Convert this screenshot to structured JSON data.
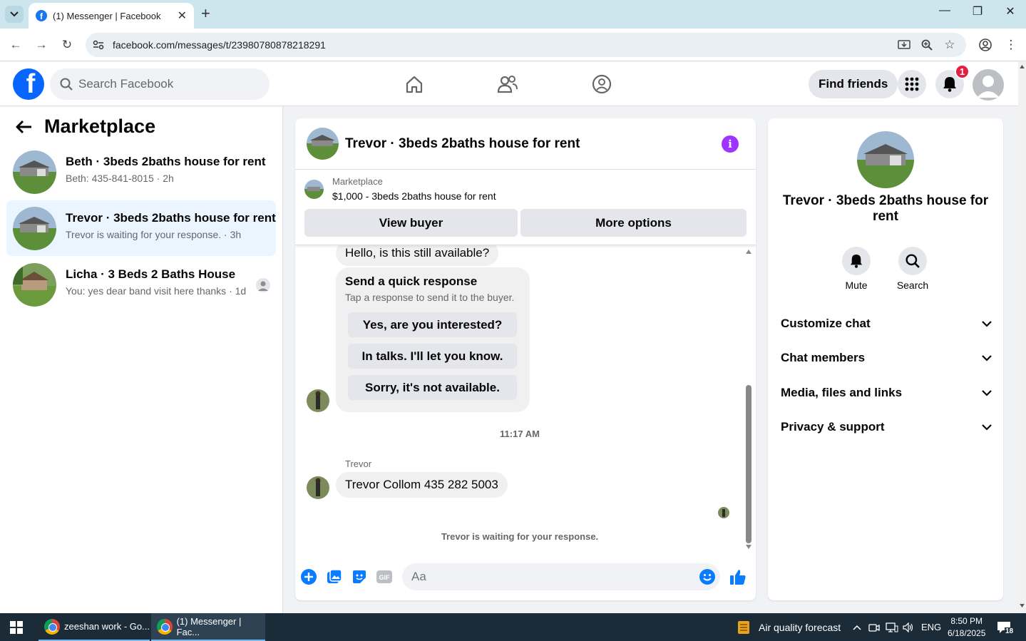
{
  "browser": {
    "tab_title": "(1) Messenger | Facebook",
    "url": "facebook.com/messages/t/23980780878218291"
  },
  "fb_header": {
    "search_placeholder": "Search Facebook",
    "find_friends": "Find friends",
    "notification_count": "1"
  },
  "left_panel": {
    "title": "Marketplace",
    "conversations": [
      {
        "name": "Beth · 3beds 2baths house for rent",
        "preview": "Beth: 435-841-8015 · 2h"
      },
      {
        "name": "Trevor · 3beds 2baths house for rent",
        "preview": "Trevor is waiting for your response. · 3h"
      },
      {
        "name": "Licha · 3 Beds 2 Baths House",
        "preview": "You: yes dear band visit here thanks · 1d"
      }
    ]
  },
  "chat": {
    "title": "Trevor · 3beds 2baths house for rent",
    "listing_source": "Marketplace",
    "listing_price": "$1,000 - 3beds 2baths house for rent",
    "view_buyer": "View buyer",
    "more_options": "More options",
    "first_message": "Hello, is this still available?",
    "quick_response_title": "Send a quick response",
    "quick_response_sub": "Tap a response to send it to the buyer.",
    "quick_responses": [
      "Yes, are you interested?",
      "In talks. I'll let you know.",
      "Sorry, it's not available."
    ],
    "timestamp": "11:17 AM",
    "sender_name": "Trevor",
    "last_message": "Trevor Collom 435 282 5003",
    "waiting_text": "Trevor is waiting for your response.",
    "composer_placeholder": "Aa"
  },
  "right_panel": {
    "name": "Trevor · 3beds 2baths house for rent",
    "mute": "Mute",
    "search": "Search",
    "sections": [
      "Customize chat",
      "Chat members",
      "Media, files and links",
      "Privacy & support"
    ]
  },
  "taskbar": {
    "app1": "zeeshan work - Go...",
    "app2": "(1) Messenger | Fac...",
    "weather": "Air quality forecast",
    "lang": "ENG",
    "time": "8:50 PM",
    "date": "6/18/2025",
    "notif_count": "18"
  },
  "colors": {
    "fb_blue": "#0866ff",
    "messenger_blue": "#0a7cff",
    "info_purple": "#a033ff",
    "badge_red": "#e41e3f"
  }
}
